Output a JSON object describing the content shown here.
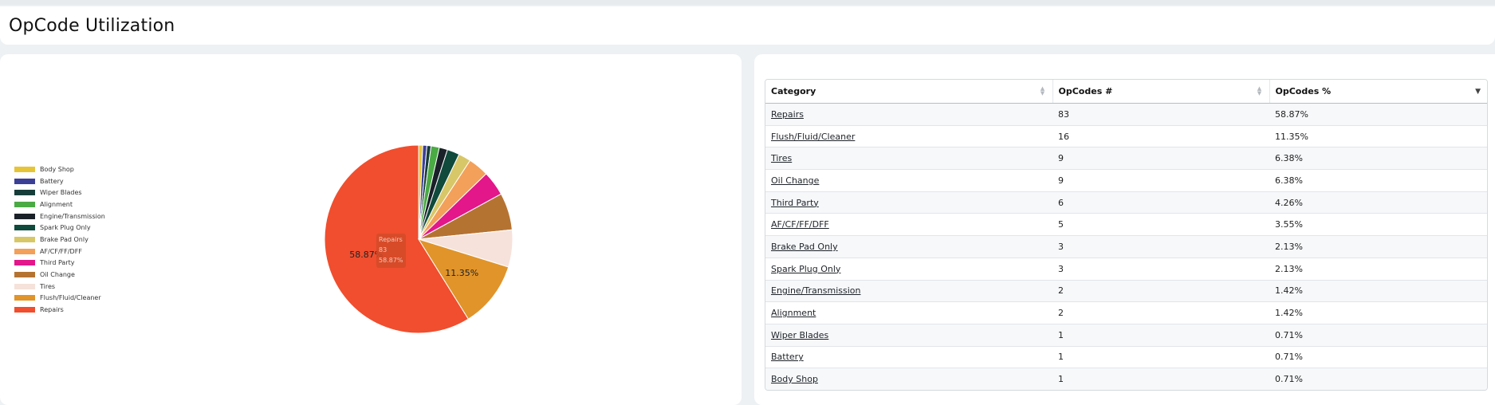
{
  "page": {
    "title": "OpCode Utilization"
  },
  "colors": {
    "Body Shop": "#e6c43a",
    "Battery": "#3c3f96",
    "Wiper Blades": "#173d3a",
    "Alignment": "#4aaa44",
    "Engine/Transmission": "#1b2129",
    "Spark Plug Only": "#0f4a3c",
    "Brake Pad Only": "#d8c768",
    "AF/CF/FF/DFF": "#f2a05a",
    "Third Party": "#e3168a",
    "Oil Change": "#b57332",
    "Tires": "#f6e2da",
    "Flush/Fluid/Cleaner": "#e0942a",
    "Repairs": "#f04e2e"
  },
  "chart_data": {
    "type": "pie",
    "slices": [
      {
        "label": "Repairs",
        "value": 83,
        "percent": "58.87%"
      },
      {
        "label": "Flush/Fluid/Cleaner",
        "value": 16,
        "percent": "11.35%"
      },
      {
        "label": "Tires",
        "value": 9,
        "percent": "6.38%"
      },
      {
        "label": "Oil Change",
        "value": 9,
        "percent": "6.38%"
      },
      {
        "label": "Third Party",
        "value": 6,
        "percent": "4.26%"
      },
      {
        "label": "AF/CF/FF/DFF",
        "value": 5,
        "percent": "3.55%"
      },
      {
        "label": "Brake Pad Only",
        "value": 3,
        "percent": "2.13%"
      },
      {
        "label": "Spark Plug Only",
        "value": 3,
        "percent": "2.13%"
      },
      {
        "label": "Engine/Transmission",
        "value": 2,
        "percent": "1.42%"
      },
      {
        "label": "Alignment",
        "value": 2,
        "percent": "1.42%"
      },
      {
        "label": "Wiper Blades",
        "value": 1,
        "percent": "0.71%"
      },
      {
        "label": "Battery",
        "value": 1,
        "percent": "0.71%"
      },
      {
        "label": "Body Shop",
        "value": 1,
        "percent": "0.71%"
      }
    ],
    "data_labels": {
      "Repairs": "58.87%",
      "Flush/Fluid/Cleaner": "11.35%"
    },
    "legend": {
      "placement": "left",
      "items": [
        "Body Shop",
        "Battery",
        "Wiper Blades",
        "Alignment",
        "Engine/Transmission",
        "Spark Plug Only",
        "Brake Pad Only",
        "AF/CF/FF/DFF",
        "Third Party",
        "Oil Change",
        "Tires",
        "Flush/Fluid/Cleaner",
        "Repairs"
      ]
    },
    "tooltip": {
      "label": "Repairs",
      "value": "83",
      "percent": "58.87%"
    }
  },
  "table": {
    "headers": {
      "category": "Category",
      "count": "OpCodes #",
      "percent": "OpCodes %"
    },
    "rows": [
      {
        "category": "Repairs",
        "count": "83",
        "percent": "58.87%"
      },
      {
        "category": "Flush/Fluid/Cleaner",
        "count": "16",
        "percent": "11.35%"
      },
      {
        "category": "Tires",
        "count": "9",
        "percent": "6.38%"
      },
      {
        "category": "Oil Change",
        "count": "9",
        "percent": "6.38%"
      },
      {
        "category": "Third Party",
        "count": "6",
        "percent": "4.26%"
      },
      {
        "category": "AF/CF/FF/DFF",
        "count": "5",
        "percent": "3.55%"
      },
      {
        "category": "Brake Pad Only",
        "count": "3",
        "percent": "2.13%"
      },
      {
        "category": "Spark Plug Only",
        "count": "3",
        "percent": "2.13%"
      },
      {
        "category": "Engine/Transmission",
        "count": "2",
        "percent": "1.42%"
      },
      {
        "category": "Alignment",
        "count": "2",
        "percent": "1.42%"
      },
      {
        "category": "Wiper Blades",
        "count": "1",
        "percent": "0.71%"
      },
      {
        "category": "Battery",
        "count": "1",
        "percent": "0.71%"
      },
      {
        "category": "Body Shop",
        "count": "1",
        "percent": "0.71%"
      }
    ]
  }
}
